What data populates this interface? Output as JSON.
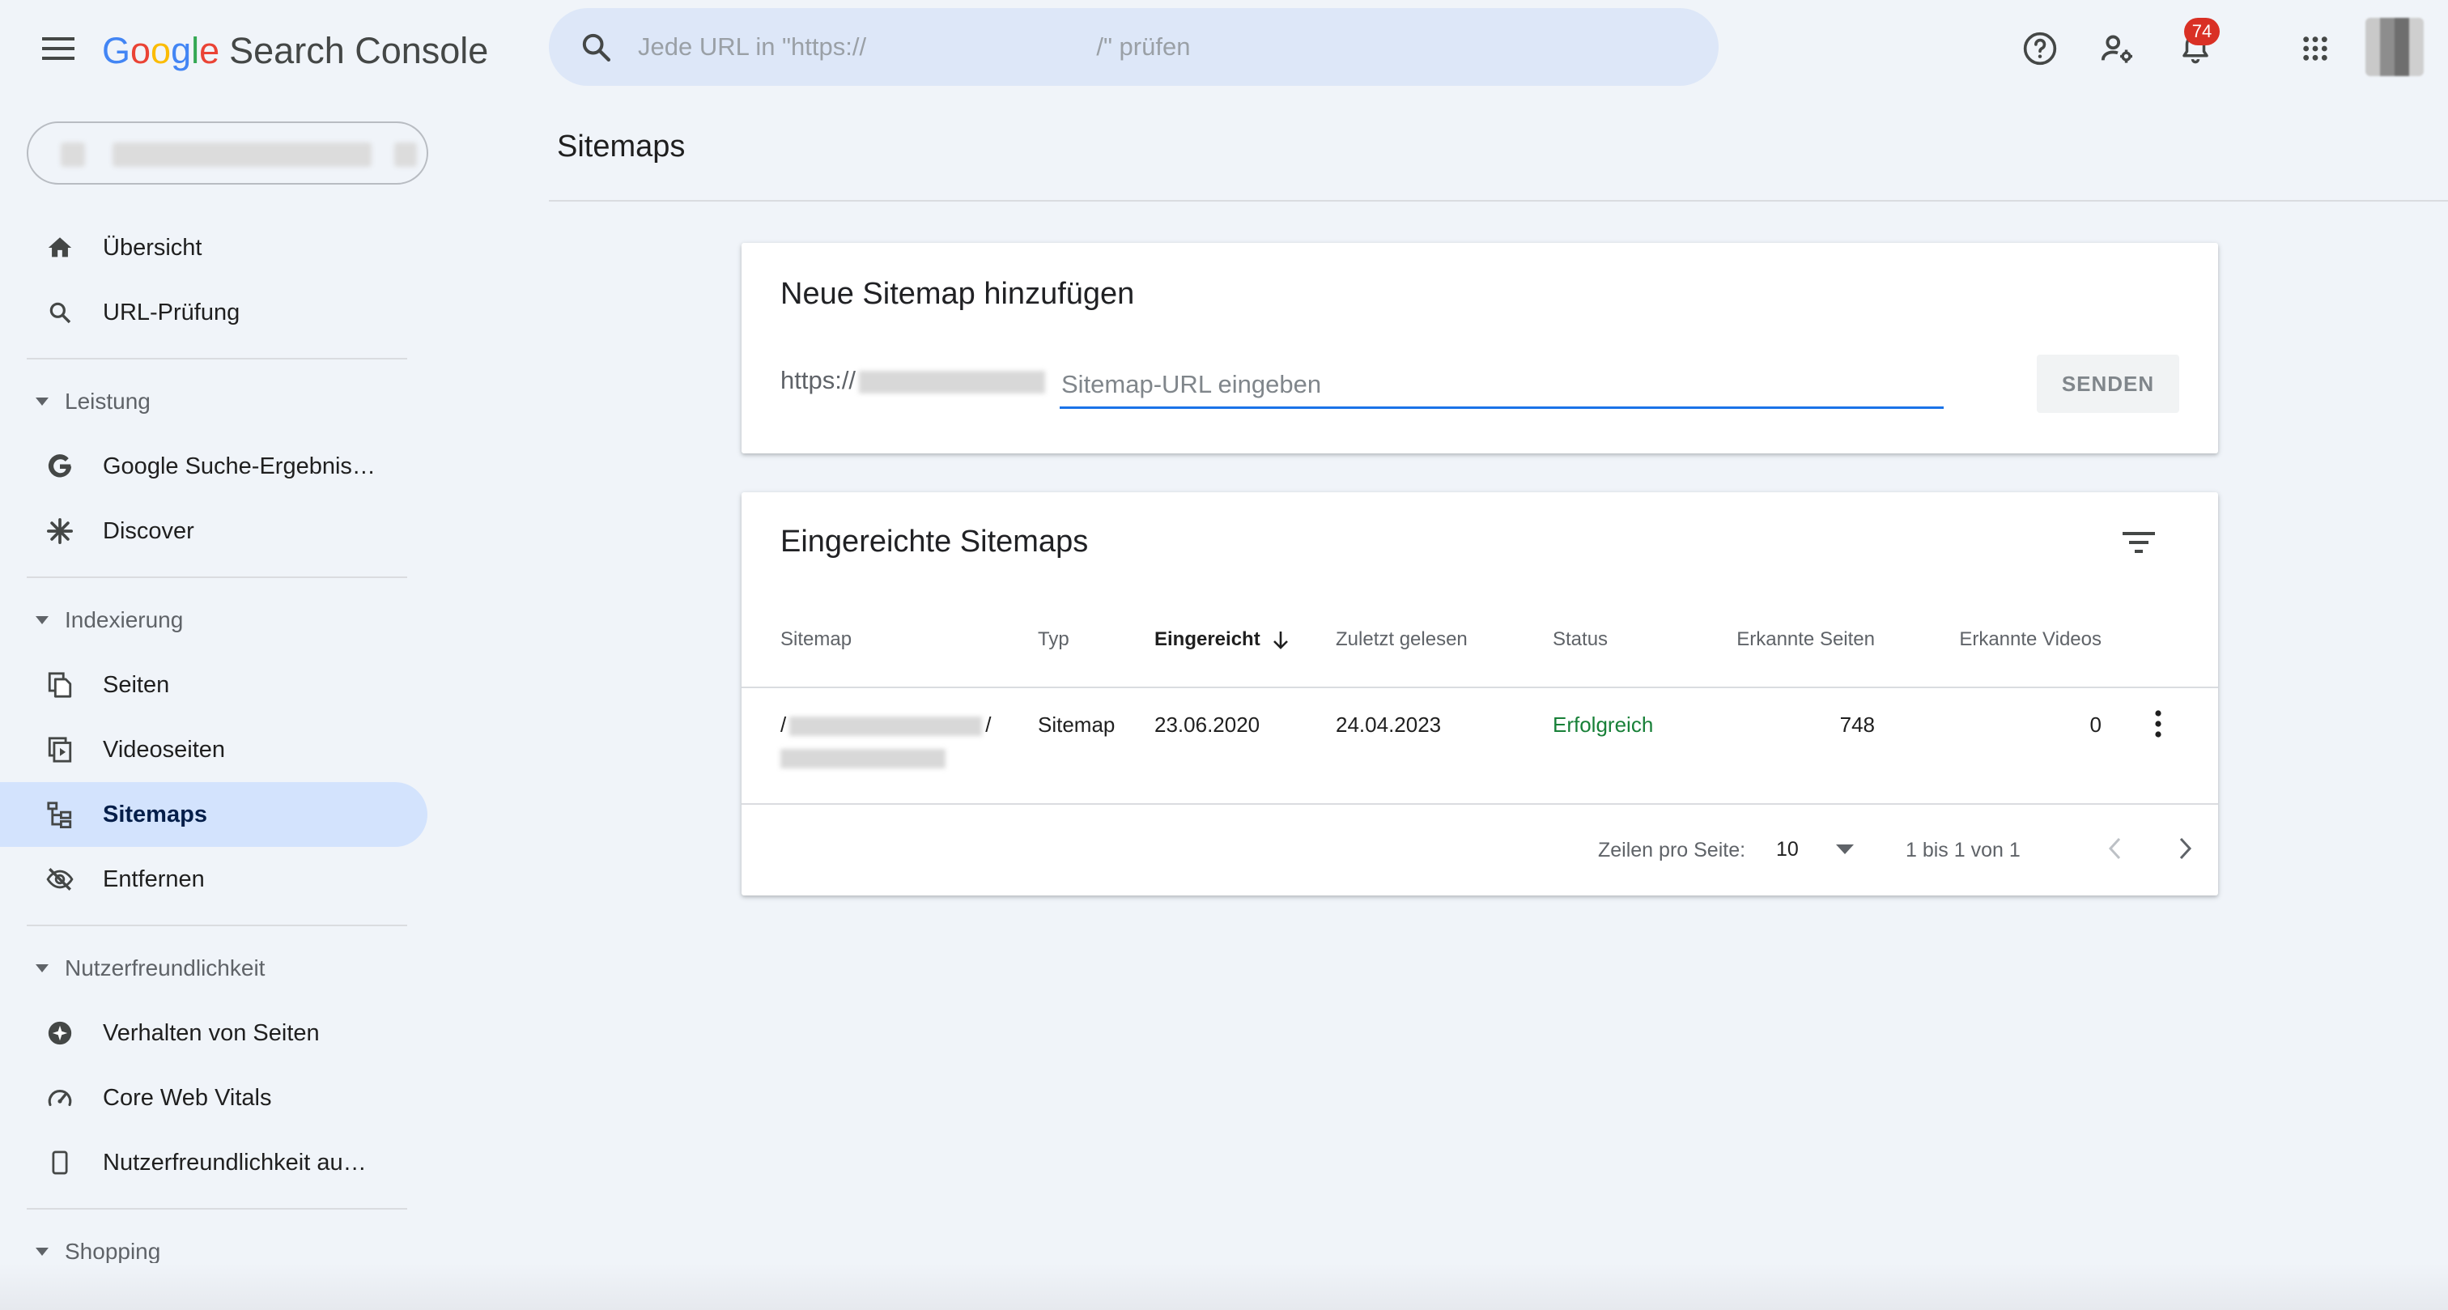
{
  "header": {
    "logo_letters": [
      {
        "char": "G",
        "color": "#4285F4"
      },
      {
        "char": "o",
        "color": "#EA4335"
      },
      {
        "char": "o",
        "color": "#FBBC05"
      },
      {
        "char": "g",
        "color": "#4285F4"
      },
      {
        "char": "l",
        "color": "#34A853"
      },
      {
        "char": "e",
        "color": "#EA4335"
      }
    ],
    "product_name": "Search Console",
    "search_placeholder": "Jede URL in \"https://                                 /\" prüfen",
    "notification_count": "74",
    "icons": [
      "menu-icon",
      "search-icon",
      "help-icon",
      "manage-users-icon",
      "notifications-icon",
      "apps-grid-icon",
      "account-avatar"
    ]
  },
  "sidebar": {
    "items": [
      {
        "label": "Übersicht",
        "icon": "home-icon"
      },
      {
        "label": "URL-Prüfung",
        "icon": "search-icon"
      },
      {
        "label": "Leistung",
        "section": true
      },
      {
        "label": "Google Suche-Ergebnis…",
        "icon": "google-g-icon"
      },
      {
        "label": "Discover",
        "icon": "asterisk-icon"
      },
      {
        "label": "Indexierung",
        "section": true
      },
      {
        "label": "Seiten",
        "icon": "pages-icon"
      },
      {
        "label": "Videoseiten",
        "icon": "video-pages-icon"
      },
      {
        "label": "Sitemaps",
        "icon": "sitemap-icon",
        "active": true
      },
      {
        "label": "Entfernen",
        "icon": "eye-off-icon"
      },
      {
        "label": "Nutzerfreundlichkeit",
        "section": true
      },
      {
        "label": "Verhalten von Seiten",
        "icon": "page-experience-icon"
      },
      {
        "label": "Core Web Vitals",
        "icon": "speedometer-icon"
      },
      {
        "label": "Nutzerfreundlichkeit au…",
        "icon": "phone-icon"
      },
      {
        "label": "Shopping",
        "section": true
      }
    ],
    "labels": {
      "overview": "Übersicht",
      "url_inspection": "URL-Prüfung",
      "performance": "Leistung",
      "search_results": "Google Suche-Ergebnis…",
      "discover": "Discover",
      "indexing": "Indexierung",
      "pages": "Seiten",
      "video_pages": "Videoseiten",
      "sitemaps": "Sitemaps",
      "removals": "Entfernen",
      "experience": "Nutzerfreundlichkeit",
      "page_experience": "Verhalten von Seiten",
      "core_web_vitals": "Core Web Vitals",
      "mobile_usability": "Nutzerfreundlichkeit au…",
      "shopping": "Shopping"
    }
  },
  "main": {
    "page_title": "Sitemaps",
    "add_card": {
      "title": "Neue Sitemap hinzufügen",
      "url_prefix": "https://",
      "input_placeholder": "Sitemap-URL eingeben",
      "input_value": "",
      "submit_label": "SENDEN"
    },
    "list_card": {
      "title": "Eingereichte Sitemaps",
      "columns": {
        "sitemap": "Sitemap",
        "type": "Typ",
        "submitted": "Eingereicht",
        "last_read": "Zuletzt gelesen",
        "status": "Status",
        "discovered_pages": "Erkannte Seiten",
        "discovered_videos": "Erkannte Videos"
      },
      "rows": [
        {
          "path_start": "/",
          "path_end": "/",
          "type": "Sitemap",
          "submitted": "23.06.2020",
          "last_read": "24.04.2023",
          "status": "Erfolgreich",
          "pages": "748",
          "videos": "0"
        }
      ],
      "pagination": {
        "rows_per_page_label": "Zeilen pro Seite:",
        "rows_per_page": "10",
        "range": "1 bis 1 von 1"
      }
    }
  },
  "colors": {
    "accent_blue": "#1a73e8",
    "active_nav_bg": "#d3e3fd",
    "success_green": "#188038",
    "badge_red": "#d93025",
    "page_bg": "#f0f4f9"
  }
}
